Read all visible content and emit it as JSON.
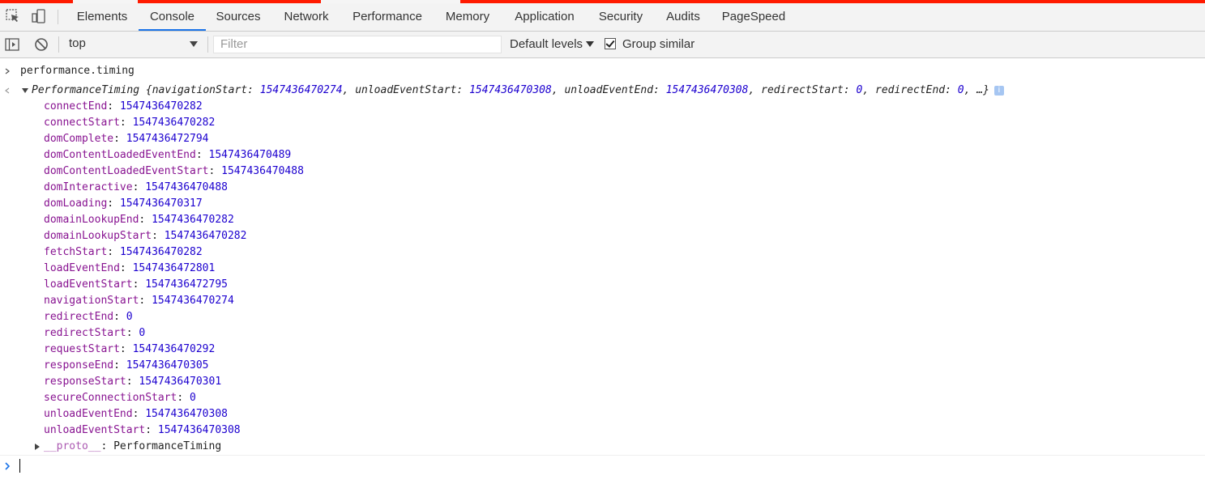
{
  "tabs": [
    "Elements",
    "Console",
    "Sources",
    "Network",
    "Performance",
    "Memory",
    "Application",
    "Security",
    "Audits",
    "PageSpeed"
  ],
  "active_tab": "Console",
  "toolbar": {
    "context": "top",
    "filter_placeholder": "Filter",
    "levels": "Default levels",
    "group_similar": "Group similar"
  },
  "console": {
    "input_command": "performance.timing",
    "object_type": "PerformanceTiming",
    "summary": [
      {
        "key": "navigationStart",
        "value": "1547436470274"
      },
      {
        "key": "unloadEventStart",
        "value": "1547436470308"
      },
      {
        "key": "unloadEventEnd",
        "value": "1547436470308"
      },
      {
        "key": "redirectStart",
        "value": "0"
      },
      {
        "key": "redirectEnd",
        "value": "0"
      }
    ],
    "summary_ellipsis": "…}",
    "properties": [
      {
        "key": "connectEnd",
        "value": "1547436470282"
      },
      {
        "key": "connectStart",
        "value": "1547436470282"
      },
      {
        "key": "domComplete",
        "value": "1547436472794"
      },
      {
        "key": "domContentLoadedEventEnd",
        "value": "1547436470489"
      },
      {
        "key": "domContentLoadedEventStart",
        "value": "1547436470488"
      },
      {
        "key": "domInteractive",
        "value": "1547436470488"
      },
      {
        "key": "domLoading",
        "value": "1547436470317"
      },
      {
        "key": "domainLookupEnd",
        "value": "1547436470282"
      },
      {
        "key": "domainLookupStart",
        "value": "1547436470282"
      },
      {
        "key": "fetchStart",
        "value": "1547436470282"
      },
      {
        "key": "loadEventEnd",
        "value": "1547436472801"
      },
      {
        "key": "loadEventStart",
        "value": "1547436472795"
      },
      {
        "key": "navigationStart",
        "value": "1547436470274"
      },
      {
        "key": "redirectEnd",
        "value": "0"
      },
      {
        "key": "redirectStart",
        "value": "0"
      },
      {
        "key": "requestStart",
        "value": "1547436470292"
      },
      {
        "key": "responseEnd",
        "value": "1547436470305"
      },
      {
        "key": "responseStart",
        "value": "1547436470301"
      },
      {
        "key": "secureConnectionStart",
        "value": "0"
      },
      {
        "key": "unloadEventEnd",
        "value": "1547436470308"
      },
      {
        "key": "unloadEventStart",
        "value": "1547436470308"
      }
    ],
    "proto_key": "__proto__",
    "proto_value": "PerformanceTiming"
  },
  "icons": {
    "inspect": "inspect-element-icon",
    "device": "device-toolbar-icon",
    "sidebar": "console-sidebar-icon",
    "clear": "clear-console-icon",
    "info": "info-icon"
  },
  "colors": {
    "accent": "#1a73e8",
    "property_key": "#881391",
    "number": "#1c00cf",
    "top_bar": "#ff1a00"
  }
}
